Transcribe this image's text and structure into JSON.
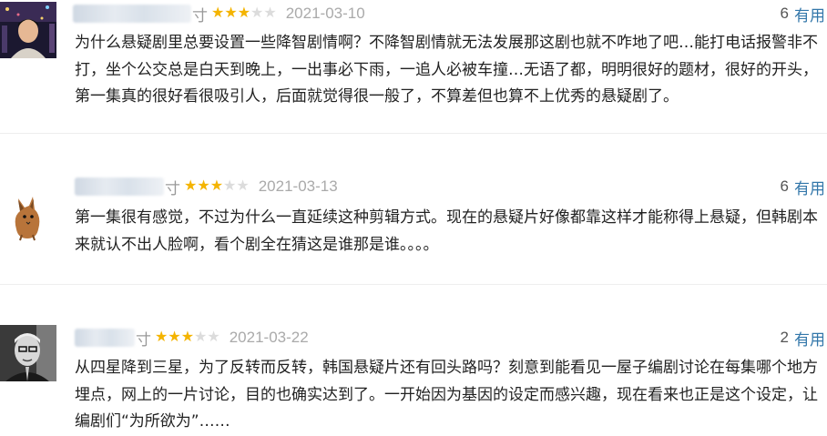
{
  "comments": [
    {
      "name_suffix": "寸",
      "rating": 3,
      "date": "2021-03-10",
      "useful_count": "6",
      "useful_label": "有用",
      "text": "为什么悬疑剧里总要设置一些降智剧情啊？不降智剧情就无法发展那这剧也就不咋地了吧…能打电话报警非不打，坐个公交总是白天到晚上，一出事必下雨，一追人必被车撞…无语了都，明明很好的题材，很好的开头，第一集真的很好看很吸引人，后面就觉得很一般了，不算差但也算不上优秀的悬疑剧了。"
    },
    {
      "name_suffix": "寸",
      "rating": 3,
      "date": "2021-03-13",
      "useful_count": "6",
      "useful_label": "有用",
      "text": "第一集很有感觉，不过为什么一直延续这种剪辑方式。现在的悬疑片好像都靠这样才能称得上悬疑，但韩剧本来就认不出人脸啊，看个剧全在猜这是谁那是谁。。。。"
    },
    {
      "name_suffix": "寸",
      "rating": 3,
      "date": "2021-03-22",
      "useful_count": "2",
      "useful_label": "有用",
      "text": "从四星降到三星，为了反转而反转，韩国悬疑片还有回头路吗？刻意到能看见一屋子编剧讨论在每集哪个地方埋点，网上的一片讨论，目的也确实达到了。一开始因为基因的设定而感兴趣，现在看来也正是这个设定，让编剧们“为所欲为”……"
    }
  ]
}
